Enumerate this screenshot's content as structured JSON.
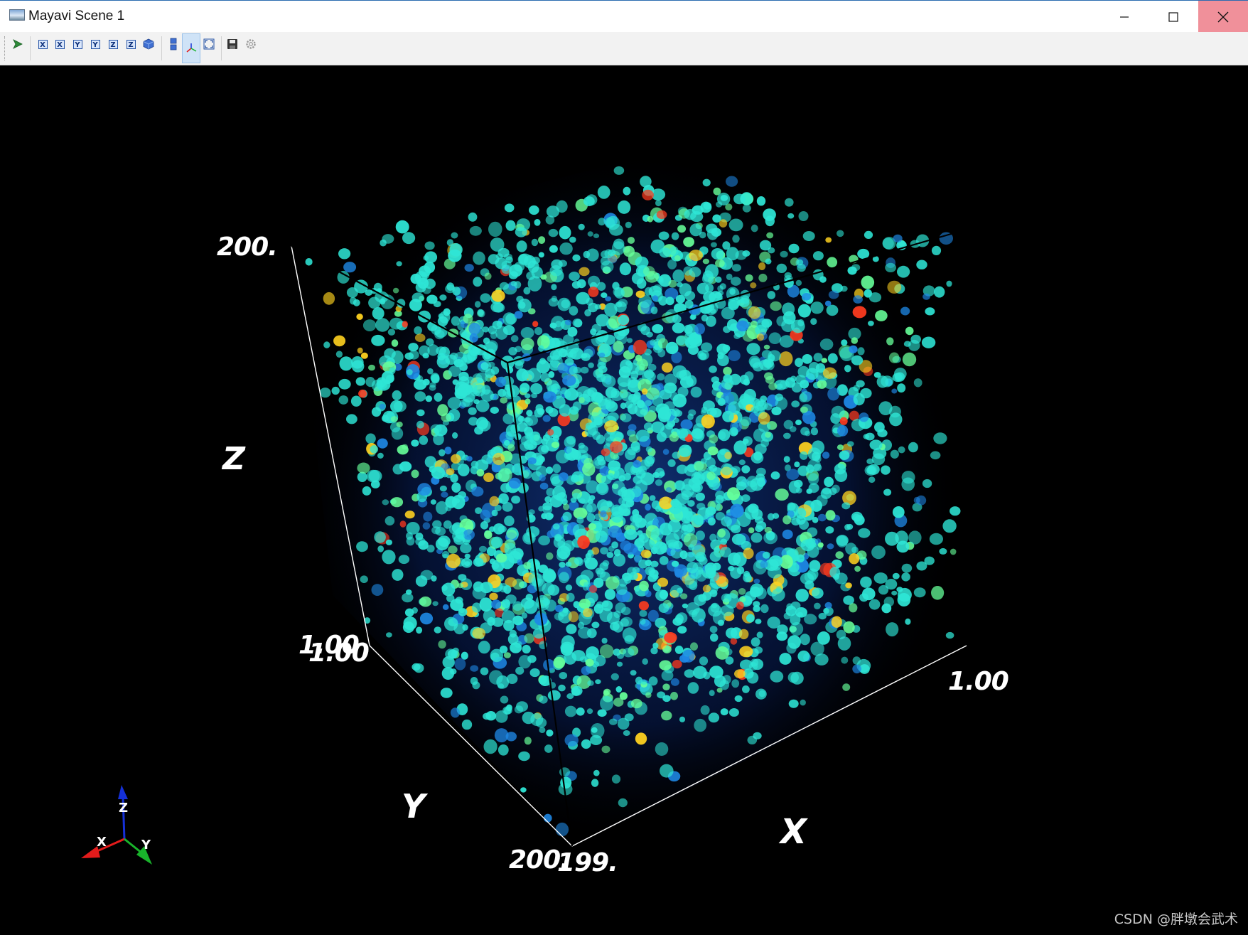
{
  "window": {
    "title": "Mayavi Scene 1",
    "icon": "mayavi-scene-icon",
    "controls": [
      "minimize-icon",
      "maximize-icon",
      "close-icon"
    ]
  },
  "toolbar": {
    "buttons": [
      {
        "name": "pipeline-icon"
      },
      {
        "name": "view-x-plus",
        "glyph": "X"
      },
      {
        "name": "view-x-minus",
        "glyph": "X"
      },
      {
        "name": "view-y-plus",
        "glyph": "Y"
      },
      {
        "name": "view-y-minus",
        "glyph": "Y"
      },
      {
        "name": "view-z-plus",
        "glyph": "Z"
      },
      {
        "name": "view-z-minus",
        "glyph": "Z"
      },
      {
        "name": "isometric-view-icon"
      },
      {
        "name": "parallel-projection-icon"
      },
      {
        "name": "axes-indicator-icon",
        "active": true
      },
      {
        "name": "full-screen-icon"
      },
      {
        "name": "save-icon"
      },
      {
        "name": "settings-icon"
      }
    ]
  },
  "scene": {
    "background": "#000000",
    "volume_colors": [
      "#0a2a6a",
      "#1e88e5",
      "#2ee6d6",
      "#66ff99",
      "#ffd21f",
      "#ff3b1f"
    ],
    "axes": {
      "z_label": "Z",
      "y_label": "Y",
      "x_label": "X",
      "z_top_tick": "200.",
      "z_bottom_tick": "1.00",
      "y_front_tick": "1.00",
      "y_back_tick": "200.",
      "x_left_tick": "199.",
      "x_right_tick": "1.00"
    },
    "orientation": {
      "x": "X",
      "y": "Y",
      "z": "Z"
    },
    "colors": {
      "x_axis": "#e31b1b",
      "y_axis": "#19b32b",
      "z_axis": "#1530d8"
    }
  },
  "watermark": "CSDN @胖墩会武术"
}
